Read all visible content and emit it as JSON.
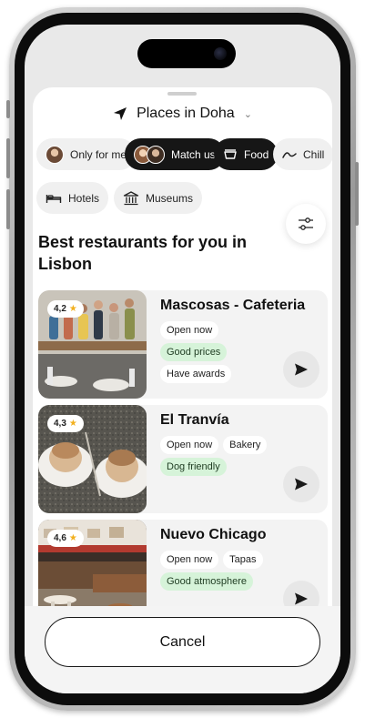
{
  "header": {
    "title": "Places in Doha",
    "location_icon": "navigation-arrow-icon",
    "dropdown_icon": "chevron-down-icon"
  },
  "chips": [
    {
      "label": "Only for me",
      "icon": "avatar",
      "selected": false
    },
    {
      "label": "Match us",
      "icon": "avatars",
      "selected": true
    },
    {
      "label": "Food",
      "icon": "bowl-icon",
      "selected": true
    },
    {
      "label": "Chill",
      "icon": "chill-icon",
      "selected": false
    },
    {
      "label": "Hotels",
      "icon": "bed-icon",
      "selected": false
    },
    {
      "label": "Museums",
      "icon": "museum-icon",
      "selected": false
    }
  ],
  "filter_icon": "sliders-icon",
  "section_title": "Best restaurants for you in Lisbon",
  "restaurants": [
    {
      "name": "Mascosas - Cafeteria",
      "rating": "4,2",
      "tags": [
        "Open now",
        "Good prices",
        "Have awards"
      ]
    },
    {
      "name": "El Tranvía",
      "rating": "4,3",
      "tags": [
        "Open now",
        "Bakery",
        "Dog friendly"
      ]
    },
    {
      "name": "Nuevo Chicago",
      "rating": "4,6",
      "tags": [
        "Open now",
        "Tapas",
        "Good atmosphere"
      ]
    }
  ],
  "cancel_label": "Cancel",
  "colors": {
    "dark_chip": "#161616",
    "green_tag": "#d6f3d9",
    "star": "#f2b01e"
  }
}
